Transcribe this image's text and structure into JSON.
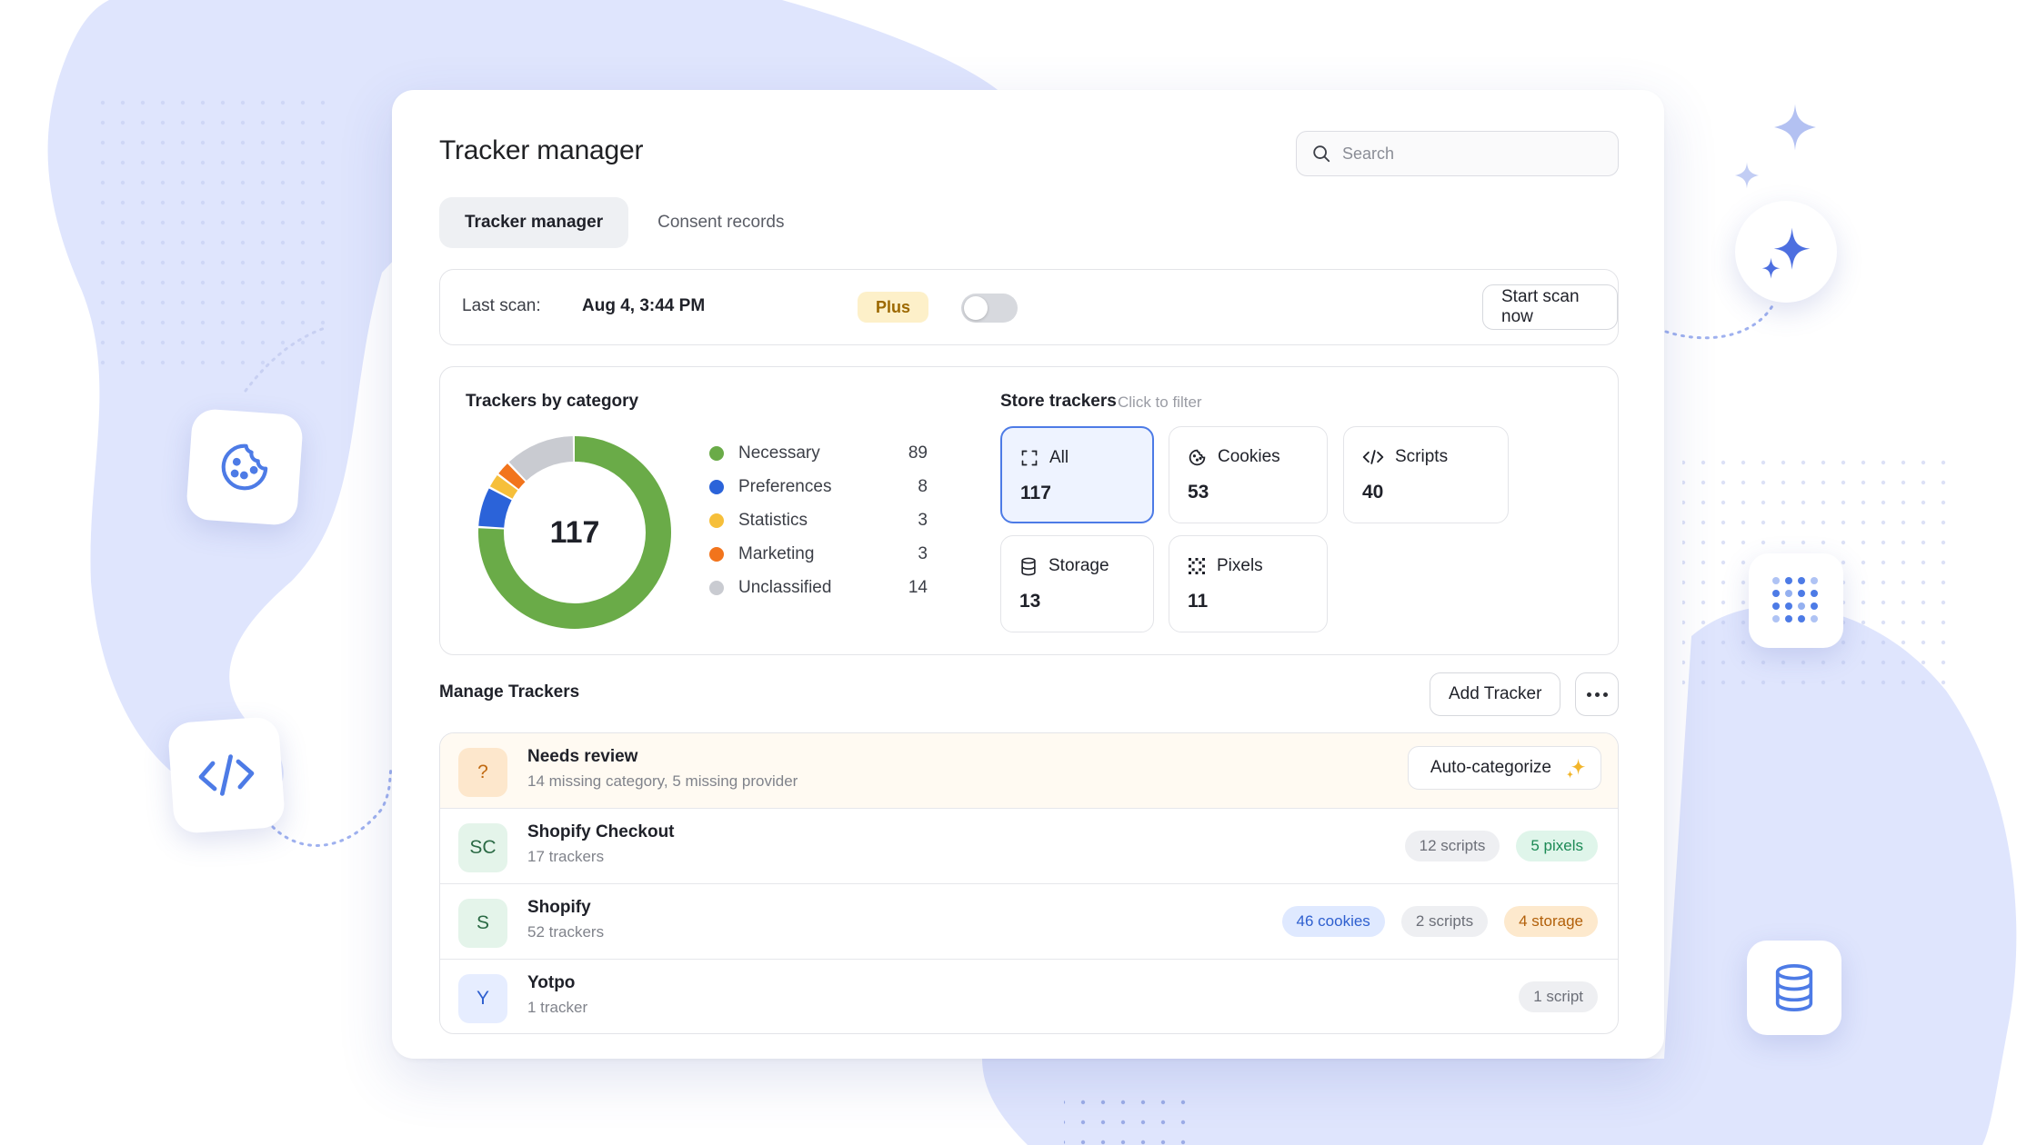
{
  "header": {
    "title": "Tracker manager",
    "search_placeholder": "Search"
  },
  "tabs": [
    {
      "label": "Tracker manager",
      "active": true
    },
    {
      "label": "Consent records",
      "active": false
    }
  ],
  "scan": {
    "label": "Last scan:",
    "date": "Aug 4, 3:44 PM",
    "badge": "Plus",
    "toggle_on": false,
    "button": "Start scan now"
  },
  "categories": {
    "title": "Trackers by category",
    "total": "117",
    "items": [
      {
        "label": "Necessary",
        "value": 89,
        "color": "#6aab48"
      },
      {
        "label": "Preferences",
        "value": 8,
        "color": "#2b63d9"
      },
      {
        "label": "Statistics",
        "value": 3,
        "color": "#f6bf3a"
      },
      {
        "label": "Marketing",
        "value": 3,
        "color": "#f2741c"
      },
      {
        "label": "Unclassified",
        "value": 14,
        "color": "#c9cbd1"
      }
    ]
  },
  "store": {
    "title": "Store trackers",
    "hint": "Click to filter",
    "cards": [
      {
        "label": "All",
        "value": "117",
        "icon": "expand-icon",
        "active": true
      },
      {
        "label": "Cookies",
        "value": "53",
        "icon": "cookie-icon",
        "active": false
      },
      {
        "label": "Scripts",
        "value": "40",
        "icon": "code-icon",
        "active": false
      },
      {
        "label": "Storage",
        "value": "13",
        "icon": "database-icon",
        "active": false
      },
      {
        "label": "Pixels",
        "value": "11",
        "icon": "pixels-icon",
        "active": false
      }
    ]
  },
  "manage": {
    "title": "Manage Trackers",
    "add_button": "Add Tracker",
    "review": {
      "icon": "?",
      "title": "Needs review",
      "subtitle": "14 missing category, 5 missing provider",
      "button": "Auto-categorize"
    },
    "rows": [
      {
        "initials": "SC",
        "name": "Shopify Checkout",
        "sub": "17 trackers",
        "avatar_bg": "#e4f4ea",
        "avatar_color": "#2b6a45",
        "pills": [
          {
            "text": "12 scripts",
            "tone": "gray"
          },
          {
            "text": "5 pixels",
            "tone": "green"
          }
        ]
      },
      {
        "initials": "S",
        "name": "Shopify",
        "sub": "52 trackers",
        "avatar_bg": "#e4f4ea",
        "avatar_color": "#2b6a45",
        "pills": [
          {
            "text": "46 cookies",
            "tone": "blue"
          },
          {
            "text": "2 scripts",
            "tone": "gray"
          },
          {
            "text": "4 storage",
            "tone": "orange"
          }
        ]
      },
      {
        "initials": "Y",
        "name": "Yotpo",
        "sub": "1 tracker",
        "avatar_bg": "#e6edff",
        "avatar_color": "#2e5fcf",
        "pills": [
          {
            "text": "1 script",
            "tone": "gray"
          }
        ]
      }
    ]
  },
  "colors": {
    "accent": "#4d7be6",
    "background_blob": "#dfe5fd"
  }
}
